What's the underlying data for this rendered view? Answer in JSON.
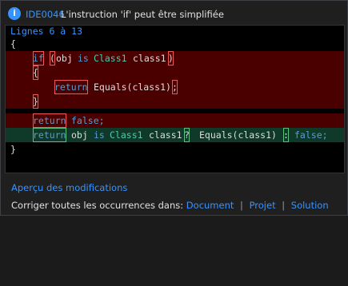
{
  "header": {
    "icon": "info-icon",
    "diagnostic_id": "IDE0046",
    "message": "L'instruction 'if' peut être simplifiée"
  },
  "code": {
    "range_label": "Lignes 6 à 13",
    "open_brace": "{",
    "close_brace": "}",
    "removed": {
      "if_kw": "if",
      "paren_open": "(",
      "obj": "obj",
      "is_kw": "is",
      "type": "Class1",
      "var": "class1",
      "paren_close": ")",
      "brace_open": "{",
      "return_kw": "return",
      "call": "Equals(class1)",
      "semicolon": ";",
      "brace_close": "}",
      "return2_kw": "return",
      "false_lit": "false;"
    },
    "added": {
      "return_kw": "return",
      "obj": "obj",
      "is_kw": "is",
      "type": "Class1",
      "var": "class1",
      "question": "?",
      "call": "Equals(class1)",
      "colon": ":",
      "false_lit": "false;"
    }
  },
  "footer": {
    "preview_label": "Aperçu des modifications",
    "fix_all_prefix": "Corriger toutes les occurrences dans:",
    "fix_all_options": [
      "Document",
      "Projet",
      "Solution"
    ],
    "separator": "|"
  },
  "colors": {
    "accent": "#3794ff",
    "removed_bg": "#4b0000",
    "removed_box": "#f0575a",
    "added_bg": "#0f3a2a",
    "added_box": "#59c281"
  }
}
